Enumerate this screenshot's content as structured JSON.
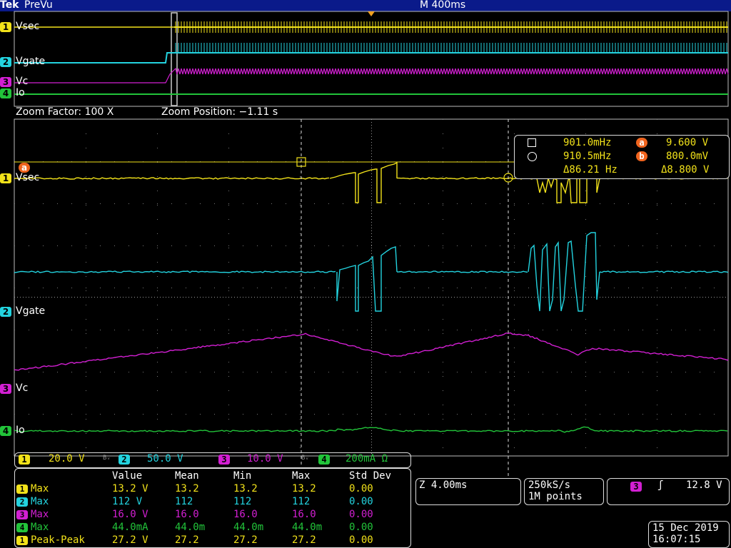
{
  "header": {
    "brand": "Tek",
    "mode": "PreVu",
    "timebase": "M 400ms"
  },
  "colors": {
    "ch1": "#f2e21a",
    "ch2": "#23d3df",
    "ch3": "#d21fd2",
    "ch4": "#22c43a",
    "marker": "#f0641e",
    "header_bg": "#0a1a8a"
  },
  "overview": {
    "channels": [
      {
        "num": "1",
        "name": "Vsec"
      },
      {
        "num": "2",
        "name": "Vgate"
      },
      {
        "num": "3",
        "name": "Vc"
      },
      {
        "num": "4",
        "name": "Io"
      }
    ]
  },
  "zoom": {
    "factor": "Zoom Factor: 100 X",
    "position": "Zoom Position: −1.11 s"
  },
  "main": {
    "channels": [
      {
        "num": "1",
        "name": "Vsec"
      },
      {
        "num": "2",
        "name": "Vgate"
      },
      {
        "num": "3",
        "name": "Vc"
      },
      {
        "num": "4",
        "name": "Io"
      }
    ],
    "ref_marker": "a"
  },
  "cursor_readout": {
    "row1_freq": "901.0mHz",
    "row1_badge": "a",
    "row1_volt": "9.600 V",
    "row2_freq": "910.5mHz",
    "row2_badge": "b",
    "row2_volt": "800.0mV",
    "delta_freq": "Δ86.21 Hz",
    "delta_volt": "Δ8.800 V"
  },
  "scales": [
    {
      "num": "1",
      "value": "20.0 V"
    },
    {
      "num": "2",
      "value": "50.0 V"
    },
    {
      "num": "3",
      "value": "10.0 V"
    },
    {
      "num": "4",
      "value": "200mA Ω"
    }
  ],
  "bw_symbol": "Bᵥ",
  "measurements": {
    "headers": [
      "Value",
      "Mean",
      "Min",
      "Max",
      "Std Dev"
    ],
    "rows": [
      {
        "num": "1",
        "label": "Max",
        "value": "13.2 V",
        "mean": "13.2",
        "min": "13.2",
        "max": "13.2",
        "std": "0.00"
      },
      {
        "num": "2",
        "label": "Max",
        "value": "112 V",
        "mean": "112",
        "min": "112",
        "max": "112",
        "std": "0.00"
      },
      {
        "num": "3",
        "label": "Max",
        "value": "16.0 V",
        "mean": "16.0",
        "min": "16.0",
        "max": "16.0",
        "std": "0.00"
      },
      {
        "num": "4",
        "label": "Max",
        "value": "44.0mA",
        "mean": "44.0m",
        "min": "44.0m",
        "max": "44.0m",
        "std": "0.00"
      },
      {
        "num": "1",
        "label": "Peak-Peak",
        "value": "27.2 V",
        "mean": "27.2",
        "min": "27.2",
        "max": "27.2",
        "std": "0.00"
      }
    ]
  },
  "zoom_timebase": "Z 4.00ms",
  "acquisition": {
    "rate": "250kS/s",
    "points": "1M points"
  },
  "trigger": {
    "num": "3",
    "slope_symbol": "ʃ",
    "level": "12.8 V"
  },
  "datetime": {
    "date": "15 Dec 2019",
    "time": "16:07:15"
  }
}
